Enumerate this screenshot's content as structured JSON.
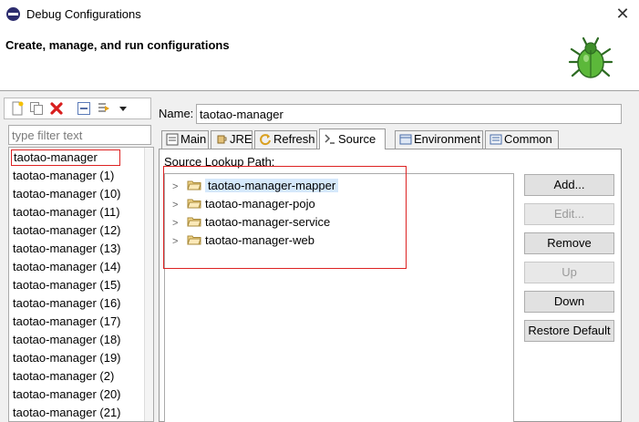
{
  "window": {
    "title": "Debug Configurations"
  },
  "header": {
    "title": "Create, manage, and run configurations"
  },
  "filter": {
    "placeholder": "type filter text"
  },
  "configurations": [
    "taotao-manager",
    "taotao-manager (1)",
    "taotao-manager (10)",
    "taotao-manager (11)",
    "taotao-manager (12)",
    "taotao-manager (13)",
    "taotao-manager (14)",
    "taotao-manager (15)",
    "taotao-manager (16)",
    "taotao-manager (17)",
    "taotao-manager (18)",
    "taotao-manager (19)",
    "taotao-manager (2)",
    "taotao-manager (20)",
    "taotao-manager (21)"
  ],
  "name": {
    "label": "Name:",
    "value": "taotao-manager"
  },
  "tabs": [
    {
      "label": "Main",
      "icon": "main-tab-icon"
    },
    {
      "label": "JRE",
      "icon": "jre-icon"
    },
    {
      "label": "Refresh",
      "icon": "refresh-icon"
    },
    {
      "label": "Source",
      "icon": "source-icon"
    },
    {
      "label": "Environment",
      "icon": "environment-icon"
    },
    {
      "label": "Common",
      "icon": "common-icon"
    }
  ],
  "source": {
    "label": "Source Lookup Path:",
    "items": [
      "taotao-manager-mapper",
      "taotao-manager-pojo",
      "taotao-manager-service",
      "taotao-manager-web"
    ]
  },
  "buttons": {
    "add": "Add...",
    "edit": "Edit...",
    "remove": "Remove",
    "up": "Up",
    "down": "Down",
    "restore": "Restore Default"
  },
  "colors": {
    "highlight_box": "#dd2222",
    "selection": "#d5e8fb",
    "bug_green": "#5cb83a"
  }
}
